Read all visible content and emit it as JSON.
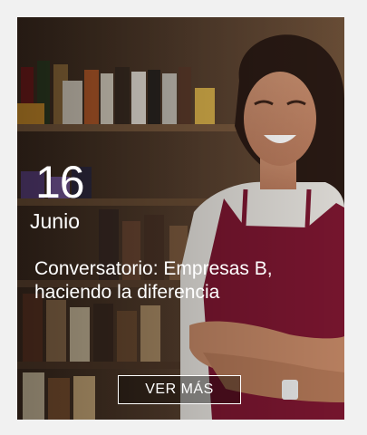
{
  "event": {
    "day": "16",
    "month": "Junio",
    "title": "Conversatorio: Empresas B, haciendo la diferencia",
    "cta_label": "VER MÁS"
  },
  "photo": {
    "icon": "woman-in-shop-photo"
  },
  "colors": {
    "page_bg": "#f1f1f1",
    "apron": "#7b1630",
    "text": "#ffffff"
  }
}
